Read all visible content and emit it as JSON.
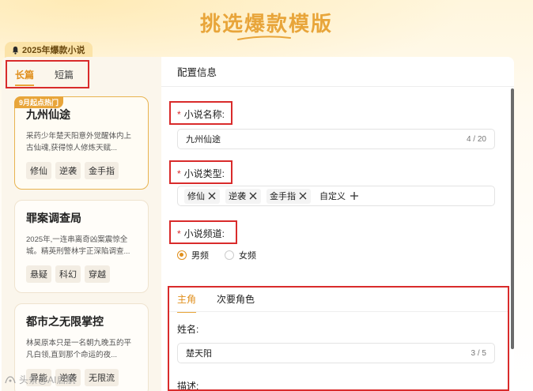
{
  "header": {
    "title": "挑选爆款模版"
  },
  "section": {
    "tag_label": "2025年爆款小说"
  },
  "tabs": [
    {
      "label": "长篇",
      "active": true
    },
    {
      "label": "短篇",
      "active": false
    }
  ],
  "cards": [
    {
      "badge": "9月起点热门",
      "title": "九州仙途",
      "desc": "采药少年楚天阳意外觉醒体内上古仙魂,获得惊人修炼天赋...",
      "tags": [
        "修仙",
        "逆袭",
        "金手指"
      ]
    },
    {
      "title": "罪案调查局",
      "desc": "2025年,一连串离奇凶案震惊全城。精英刑警林宇正深陷调查...",
      "tags": [
        "悬疑",
        "科幻",
        "穿越"
      ]
    },
    {
      "title": "都市之无限掌控",
      "desc": "林昊原本只是一名朝九晚五的平凡白领,直到那个命运的夜...",
      "tags": [
        "异能",
        "逆袭",
        "无限流"
      ]
    }
  ],
  "config": {
    "header": "配置信息",
    "name_label": "小说名称:",
    "name_value": "九州仙途",
    "name_counter": "4 / 20",
    "type_label": "小说类型:",
    "type_tags": [
      "修仙",
      "逆袭",
      "金手指"
    ],
    "custom_label": "自定义",
    "channel_label": "小说频道:",
    "channel_options": [
      {
        "label": "男频",
        "selected": true
      },
      {
        "label": "女频",
        "selected": false
      }
    ],
    "role_tabs": [
      {
        "label": "主角",
        "active": true
      },
      {
        "label": "次要角色",
        "active": false
      }
    ],
    "role_name_label": "姓名:",
    "role_name_value": "楚天阳",
    "role_name_counter": "3 / 5",
    "role_desc_label": "描述:"
  },
  "watermark": {
    "text": "头条@AI启航"
  },
  "colors": {
    "accent": "#e8a53a",
    "highlight_box": "#d92b2b",
    "card_bg": "#fbf6ec"
  },
  "icons": [
    "bell-icon",
    "close-icon",
    "plus-icon"
  ]
}
